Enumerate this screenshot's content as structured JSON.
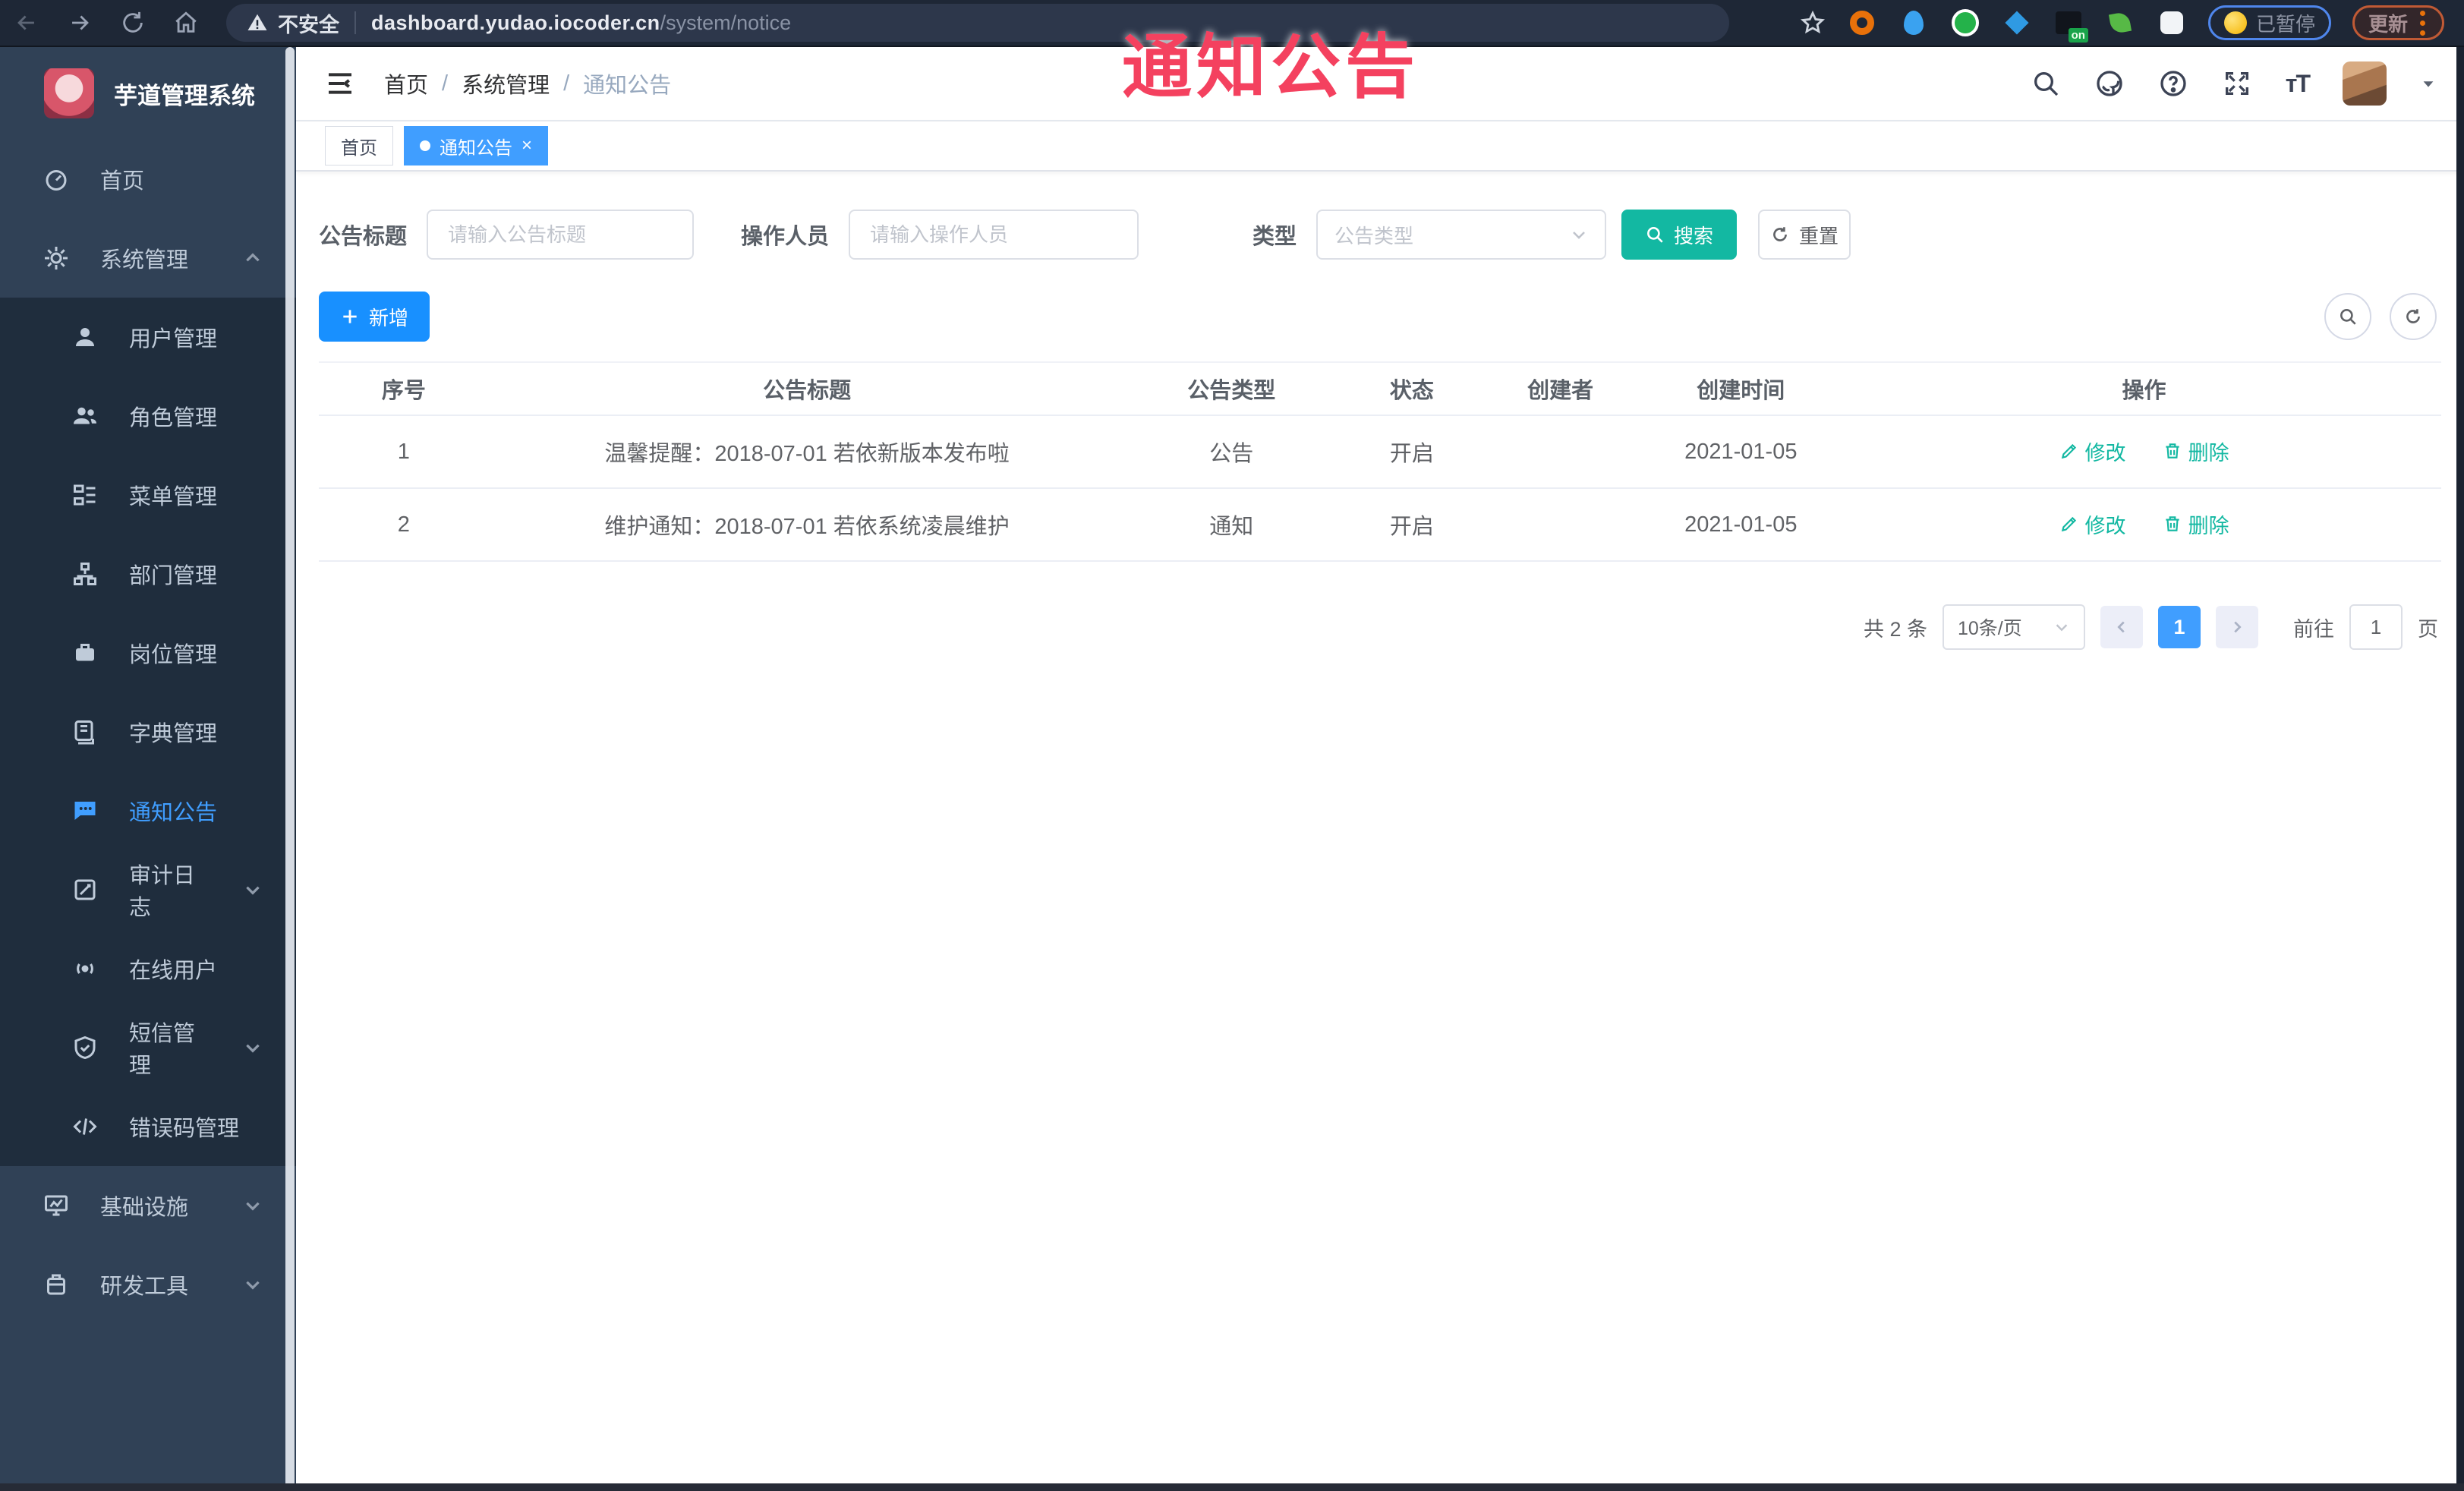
{
  "browser": {
    "security_label": "不安全",
    "url_host": "dashboard.yudao.iocoder.cn",
    "url_path": "/system/notice",
    "paused_badge": "已暂停",
    "update_button": "更新",
    "on_badge": "on"
  },
  "watermark": "通知公告",
  "sidebar": {
    "title": "芋道管理系统",
    "items": [
      {
        "label": "首页"
      },
      {
        "label": "系统管理"
      },
      {
        "label": "用户管理"
      },
      {
        "label": "角色管理"
      },
      {
        "label": "菜单管理"
      },
      {
        "label": "部门管理"
      },
      {
        "label": "岗位管理"
      },
      {
        "label": "字典管理"
      },
      {
        "label": "通知公告"
      },
      {
        "label": "审计日志"
      },
      {
        "label": "在线用户"
      },
      {
        "label": "短信管理"
      },
      {
        "label": "错误码管理"
      },
      {
        "label": "基础设施"
      },
      {
        "label": "研发工具"
      }
    ]
  },
  "navbar": {
    "breadcrumb": {
      "home": "首页",
      "section": "系统管理",
      "current": "通知公告"
    }
  },
  "tags": {
    "home": "首页",
    "current": "通知公告",
    "close": "×"
  },
  "filter": {
    "title_label": "公告标题",
    "title_placeholder": "请输入公告标题",
    "operator_label": "操作人员",
    "operator_placeholder": "请输入操作人员",
    "type_label": "类型",
    "type_placeholder": "公告类型",
    "search_label": "搜索",
    "reset_label": "重置"
  },
  "toolbar": {
    "add_label": "新增"
  },
  "table": {
    "headers": [
      "序号",
      "公告标题",
      "公告类型",
      "状态",
      "创建者",
      "创建时间",
      "操作"
    ],
    "edit_label": "修改",
    "delete_label": "删除",
    "rows": [
      {
        "no": "1",
        "title": "温馨提醒：2018-07-01 若依新版本发布啦",
        "type": "公告",
        "status": "开启",
        "creator": "",
        "created": "2021-01-05"
      },
      {
        "no": "2",
        "title": "维护通知：2018-07-01 若依系统凌晨维护",
        "type": "通知",
        "status": "开启",
        "creator": "",
        "created": "2021-01-05"
      }
    ]
  },
  "pagination": {
    "total": "共 2 条",
    "page_size": "10条/页",
    "current_page": "1",
    "goto_label": "前往",
    "goto_value": "1",
    "page_unit": "页"
  },
  "colors": {
    "accent_blue": "#409eff",
    "primary_blue": "#1890ff",
    "teal": "#13b8a2",
    "watermark_red": "#f4415f",
    "sidebar_bg": "#304156",
    "submenu_bg": "#1f2d3d"
  }
}
